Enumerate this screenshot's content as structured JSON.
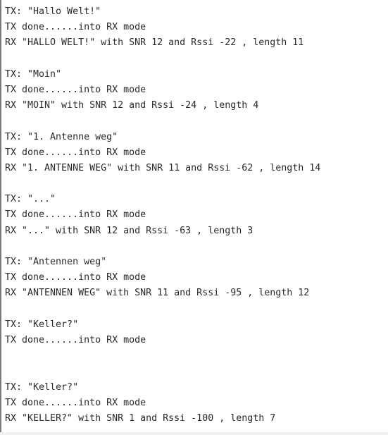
{
  "console": {
    "lines": [
      "TX: \"Hallo Welt!\"",
      "TX done......into RX mode",
      "RX \"HALLO WELT!\" with SNR 12 and Rssi -22 , length 11",
      "",
      "TX: \"Moin\"",
      "TX done......into RX mode",
      "RX \"MOIN\" with SNR 12 and Rssi -24 , length 4",
      "",
      "TX: \"1. Antenne weg\"",
      "TX done......into RX mode",
      "RX \"1. ANTENNE WEG\" with SNR 11 and Rssi -62 , length 14",
      "",
      "TX: \"...\"",
      "TX done......into RX mode",
      "RX \"...\" with SNR 12 and Rssi -63 , length 3",
      "",
      "TX: \"Antennen weg\"",
      "TX done......into RX mode",
      "RX \"ANTENNEN WEG\" with SNR 11 and Rssi -95 , length 12",
      "",
      "TX: \"Keller?\"",
      "TX done......into RX mode",
      "",
      "",
      "TX: \"Keller?\"",
      "TX done......into RX mode",
      "RX \"KELLER?\" with SNR 1 and Rssi -100 , length 7"
    ]
  }
}
